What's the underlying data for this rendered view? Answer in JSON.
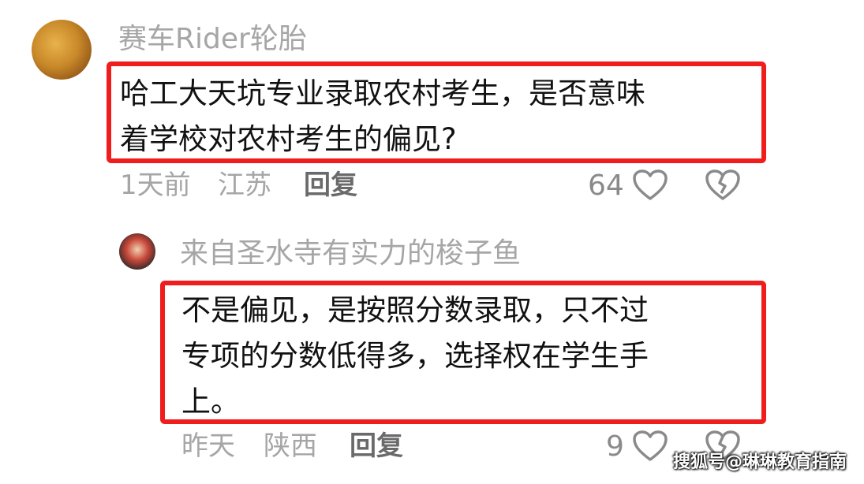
{
  "comments": [
    {
      "username": "赛车Rider轮胎",
      "text": "哈工大天坑专业录取农村考生，是否意味\n着学校对农村考生的偏见?",
      "time": "1天前",
      "location": "江苏",
      "reply_label": "回复",
      "likes": "64"
    },
    {
      "username": "来自圣水寺有实力的梭子鱼",
      "text": "不是偏见，是按照分数录取，只不过\n专项的分数低得多，选择权在学生手\n上。",
      "time": "昨天",
      "location": "陕西",
      "reply_label": "回复",
      "likes": "9"
    }
  ],
  "watermark": "搜狐号@琳琳教育指南",
  "colors": {
    "highlight_border": "#f01d1d",
    "muted_text": "#a6a6a6"
  },
  "icons": [
    "avatar",
    "heart-outline-icon",
    "broken-heart-icon"
  ]
}
